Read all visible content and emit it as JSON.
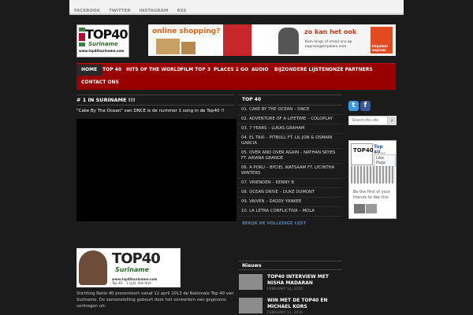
{
  "topbar": {
    "links": [
      "FACEBOOK",
      "TWITTER",
      "INSTAGRAM",
      "RSS"
    ]
  },
  "logo": {
    "text": "TOP40",
    "sub": "Suriname",
    "url": "www.top40suriname.com"
  },
  "banner": {
    "headline": "online shopping?",
    "tagline": "zo kan het ook",
    "small": "Kom langs of email ons op express@kirpalani.com",
    "brand": "kirpalani express"
  },
  "nav": {
    "items": [
      "HOME",
      "TOP 40",
      "HITS OF THE WORLD",
      "FILM TOP 3",
      "PLACES 2 GO",
      "AUDIO",
      "BIJZONDERE LIJSTEN",
      "ONZE PARTNERS",
      "CONTACT ONS"
    ]
  },
  "main": {
    "title": "# 1 IN SURINAME !!!",
    "intro": "\"Cake By The Ocean\" van DNCE is de nummer 1 song in de Top40 !!",
    "promo": {
      "title": "TOP40",
      "sub": "Suriname",
      "url": "www.top40suriname.com",
      "slogan": "Top 40... 1 Lijst, Alle Hits!"
    },
    "body": "Stichting Natio 40 presenteert vanaf 12 april 2013 de Nationale Top 40 van Suriname. De samenstelling gebeurt door het verwerken van gegevens verkregen uit:"
  },
  "top40": {
    "heading": "TOP 40",
    "items": [
      "01. CAKE BY THE OCEAN – DNCE",
      "02. ADVENTURE OF A LIFETIME – COLDPLAY",
      "03. 7 YEARS – LUKAS GRAHAM",
      "04. EL TAXI – PITBULL FT. LIL JON & OSMANI GARCIA",
      "05. OVER AND OVER AGAIN – NATHAN SKYES FT. ARIANA GRANDE",
      "06. A POKU – BYCIEL WATSAAM FT. LYCINTHA WINTERS",
      "07. VRIENDEN – KENNY B",
      "08. OCEAN DRIVE – DUKE DUMONT",
      "09. VAIVEN – DADDY YANKEE",
      "10. LA LETRA CONFLICTIVA – MOLA"
    ],
    "more": "BEKIJK DE VOLLEDIGE LIJST"
  },
  "news": {
    "heading": "Nieuws",
    "items": [
      {
        "title": "TOP40 INTERVIEW MET NISHA MADARAN",
        "date": "FEBRUARY 12, 2016"
      },
      {
        "title": "WIN MET DE TOP40 EN MICHAEL KORS",
        "date": "FEBRUARY 11, 2016"
      }
    ]
  },
  "sidebar": {
    "search_placeholder": "Search this site",
    "fb": {
      "name": "Top 40...",
      "like": "Like Page",
      "friends": "Be the first of your friends to like this"
    }
  }
}
